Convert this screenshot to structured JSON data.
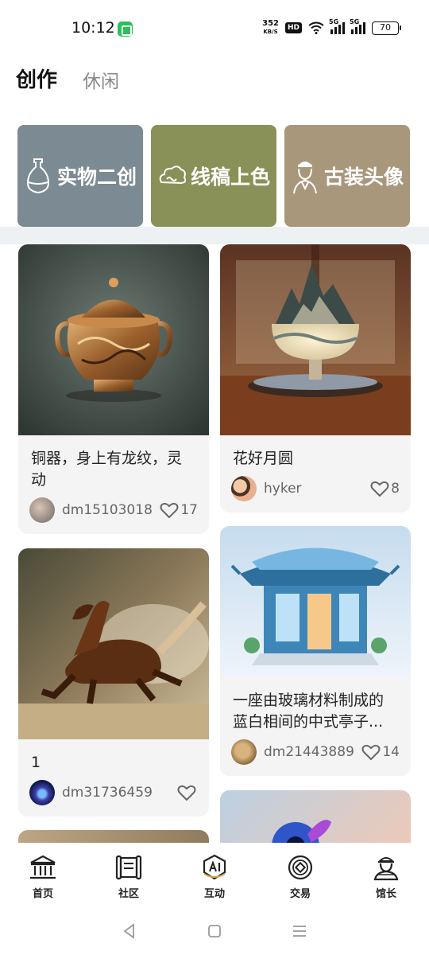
{
  "status_bar": {
    "time": "10:12",
    "net_speed_value": "352",
    "net_speed_unit": "KB/S",
    "hd_badge": "HD",
    "signal1_label": "5G",
    "signal2_label": "5G",
    "battery": "70"
  },
  "top_tabs": [
    {
      "label": "创作",
      "active": true
    },
    {
      "label": "休闲",
      "active": false
    }
  ],
  "categories": [
    {
      "label": "实物二创",
      "icon": "vase-icon",
      "color": "#7c8a93"
    },
    {
      "label": "线稿上色",
      "icon": "cloud-icon",
      "color": "#8a9158"
    },
    {
      "label": "古装头像",
      "icon": "ancient-figure-icon",
      "color": "#a9977c"
    }
  ],
  "feed": {
    "cards": [
      {
        "title": "铜器，身上有龙纹，灵动",
        "author": "dm15103018",
        "likes": "17"
      },
      {
        "title": "花好月圆",
        "author": "hyker",
        "likes": "8"
      },
      {
        "title": "1",
        "author": "dm31736459",
        "likes": ""
      },
      {
        "title": "一座由玻璃材料制成的蓝白相间的中式亭子...",
        "author": "dm21443889",
        "likes": "14"
      }
    ]
  },
  "bottom_nav": [
    {
      "label": "首页",
      "icon": "museum-icon"
    },
    {
      "label": "社区",
      "icon": "scroll-icon"
    },
    {
      "label": "互动",
      "icon": "ai-icon"
    },
    {
      "label": "交易",
      "icon": "coin-icon"
    },
    {
      "label": "馆长",
      "icon": "curator-icon"
    }
  ],
  "colors": {
    "accent": "#111111",
    "card_bg": "#f4f4f4",
    "band": "#eef1f3"
  }
}
